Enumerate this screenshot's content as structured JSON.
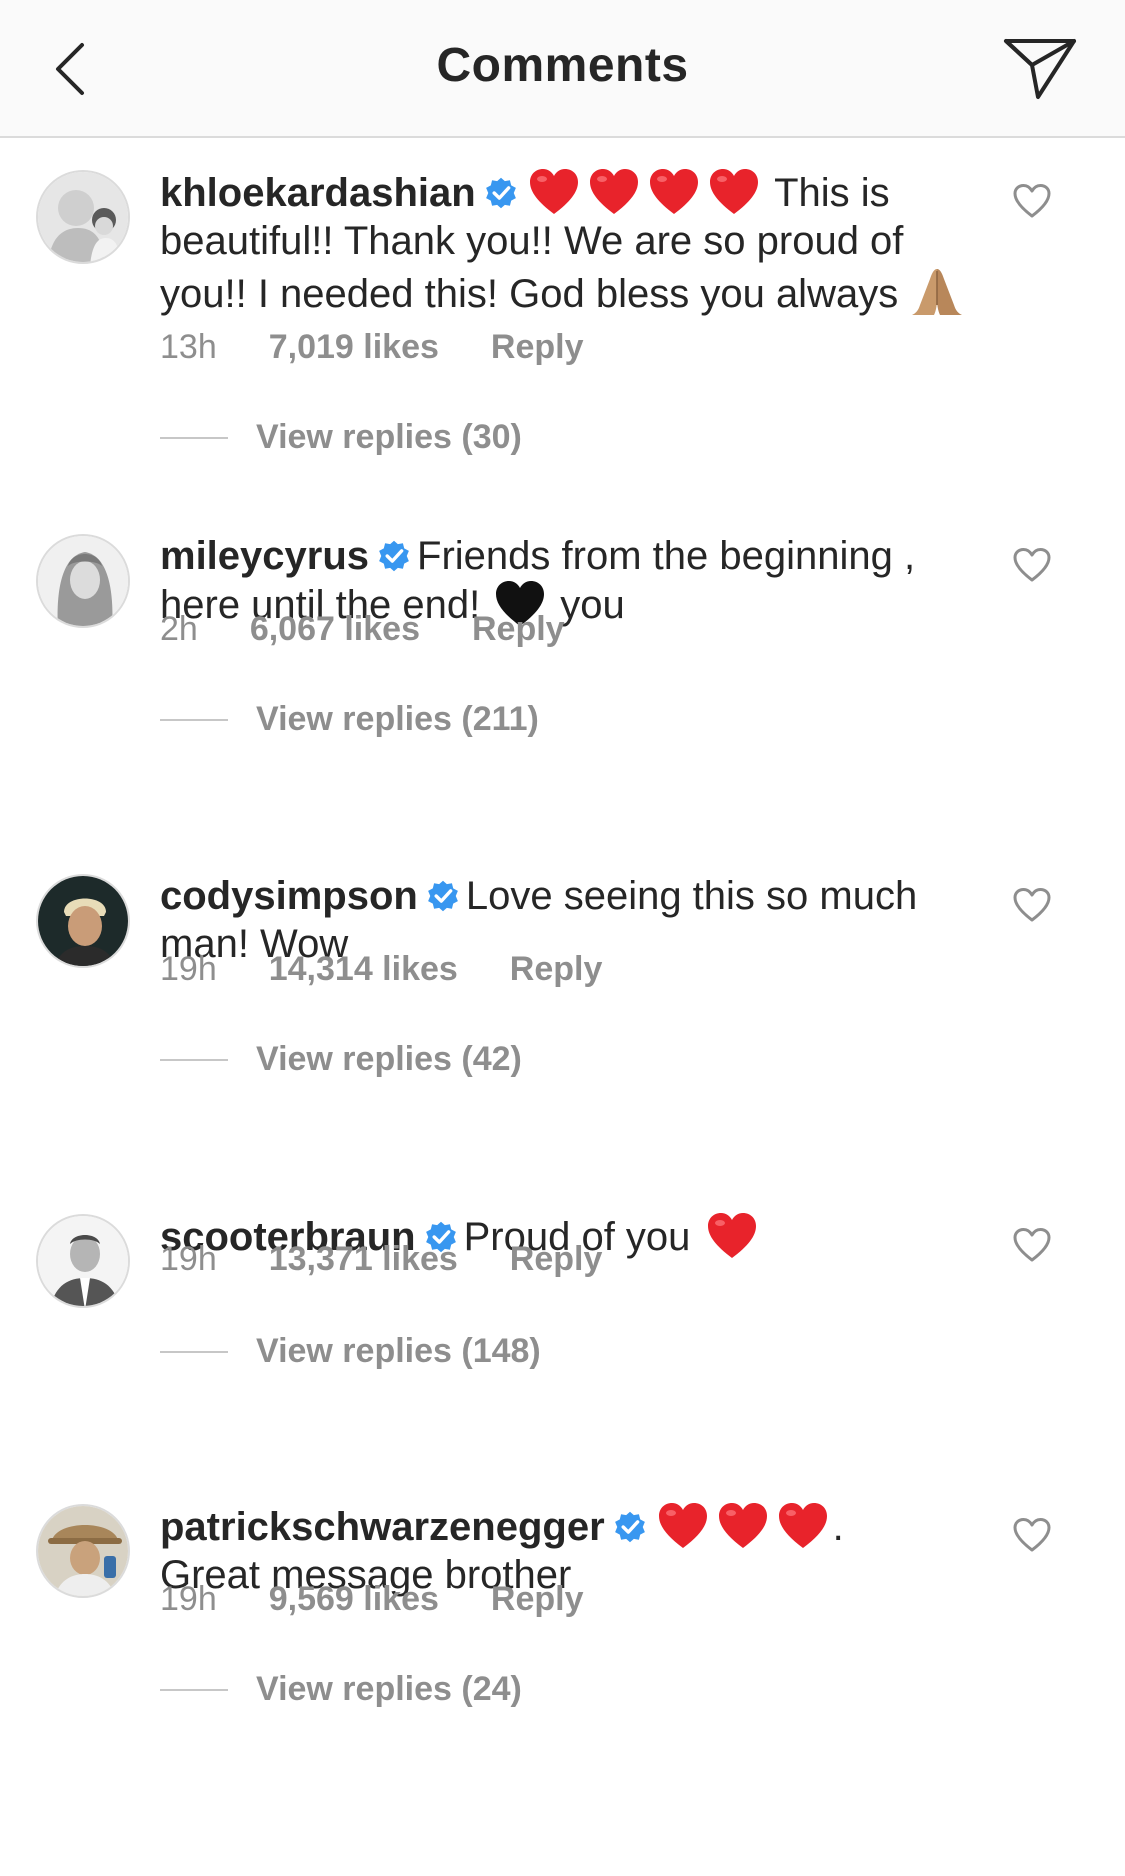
{
  "header": {
    "title": "Comments",
    "back_icon": "chevron-left-icon",
    "send_icon": "paper-plane-icon"
  },
  "colors": {
    "meta_gray": "#8e8e8e",
    "verified_blue": "#3897f0",
    "heart_red": "#ed1c24",
    "text": "#262626"
  },
  "comments": [
    {
      "username": "khloekardashian",
      "verified": true,
      "text_after_emoji": "This is beautiful!! Thank you!! We are so proud of you!! I needed this! God bless you always",
      "emoji_hearts": 4,
      "time": "13h",
      "likes": "7,019 likes",
      "reply": "Reply",
      "view_replies": "View replies (30)"
    },
    {
      "username": "mileycyrus",
      "verified": true,
      "text": "Friends from the beginning , here until the end!",
      "text_end": "you",
      "time": "2h",
      "likes": "6,067 likes",
      "reply": "Reply",
      "view_replies": "View replies (211)"
    },
    {
      "username": "codysimpson",
      "verified": true,
      "text": "Love seeing this so much man! Wow",
      "time": "19h",
      "likes": "14,314 likes",
      "reply": "Reply",
      "view_replies": "View replies (42)"
    },
    {
      "username": "scooterbraun",
      "verified": true,
      "text": "Proud of you",
      "time": "19h",
      "likes": "13,371 likes",
      "reply": "Reply",
      "view_replies": "View replies (148)"
    },
    {
      "username": "patrickschwarzenegger",
      "verified": true,
      "text_after_emoji": ".",
      "text_line2": "Great message brother",
      "emoji_hearts": 3,
      "time": "19h",
      "likes": "9,569 likes",
      "reply": "Reply",
      "view_replies": "View replies (24)"
    }
  ]
}
